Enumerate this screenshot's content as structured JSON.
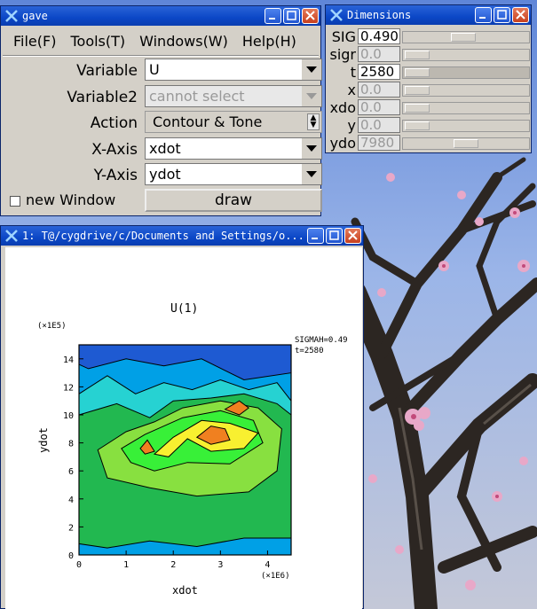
{
  "gave": {
    "title": "gave",
    "menu": [
      "File(F)",
      "Tools(T)",
      "Windows(W)",
      "Help(H)"
    ],
    "variable_label": "Variable",
    "variable_value": "U",
    "variable2_label": "Variable2",
    "variable2_value": "cannot select",
    "action_label": "Action",
    "action_value": "Contour & Tone",
    "xaxis_label": "X-Axis",
    "xaxis_value": "xdot",
    "yaxis_label": "Y-Axis",
    "yaxis_value": "ydot",
    "new_window_label": "new Window",
    "draw_label": "draw"
  },
  "dimensions": {
    "title": "Dimensions",
    "rows": [
      {
        "label": "SIG",
        "value": "0.490",
        "enabled": true,
        "slider_frac": 0.47
      },
      {
        "label": "sigr",
        "value": "0.0",
        "enabled": false,
        "slider_frac": 0.0
      },
      {
        "label": "t",
        "value": "2580",
        "enabled": true,
        "slider_frac": 0.0
      },
      {
        "label": "x",
        "value": "0.0",
        "enabled": false,
        "slider_frac": 0.0
      },
      {
        "label": "xdo",
        "value": "0.0",
        "enabled": false,
        "slider_frac": 0.0
      },
      {
        "label": "y",
        "value": "0.0",
        "enabled": false,
        "slider_frac": 0.0
      },
      {
        "label": "ydo",
        "value": "7980",
        "enabled": false,
        "slider_frac": 0.5
      }
    ]
  },
  "plot_window": {
    "title": "1: T@/cygdrive/c/Documents and Settings/o...",
    "plot_title": "U(1)",
    "annotation1": "SIGMAH=0.49",
    "annotation2": "t=2580",
    "yscale": "(×1E5)",
    "xscale": "(×1E6)",
    "xlabel": "xdot",
    "ylabel": "ydot"
  },
  "chart_data": {
    "type": "heatmap",
    "title": "U(1)",
    "xlabel": "xdot",
    "ylabel": "ydot",
    "x_ticks": [
      "0",
      "1",
      "2",
      "3",
      "4"
    ],
    "y_ticks": [
      "0",
      "2",
      "4",
      "6",
      "8",
      "10",
      "12",
      "14"
    ],
    "xlim": [
      0,
      4.5
    ],
    "ylim": [
      0,
      15
    ],
    "x_multiplier": "(×1E6)",
    "y_multiplier": "(×1E5)",
    "colors": [
      "#1e5ad2",
      "#00a0e6",
      "#26d2d2",
      "#22b850",
      "#88e040",
      "#38f038",
      "#f8f030",
      "#f08020"
    ]
  }
}
